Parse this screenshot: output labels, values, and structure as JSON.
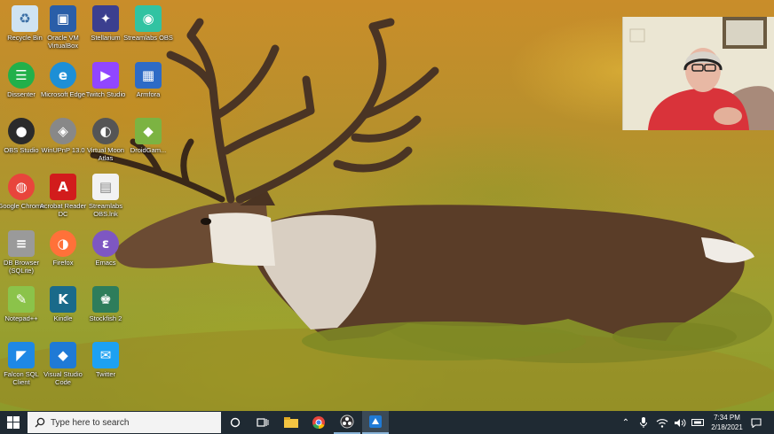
{
  "desktop": {
    "icons": [
      {
        "label": "Recycle Bin",
        "icon": "recycle-bin-icon",
        "color": "#cfe3f2"
      },
      {
        "label": "Oracle VM VirtualBox",
        "icon": "virtualbox-icon",
        "color": "#2a5ea8"
      },
      {
        "label": "Stellarium",
        "icon": "stellarium-icon",
        "color": "#3b3f8f"
      },
      {
        "label": "Streamlabs OBS",
        "icon": "streamlabs-icon",
        "color": "#31c3a2"
      },
      {
        "label": "Dissenter",
        "icon": "dissenter-icon",
        "color": "#22b04a"
      },
      {
        "label": "Microsoft Edge",
        "icon": "edge-icon",
        "color": "#1d8fd6"
      },
      {
        "label": "Twitch Studio",
        "icon": "twitch-icon",
        "color": "#9146ff"
      },
      {
        "label": "Armfora",
        "icon": "armfora-icon",
        "color": "#2e6bc6"
      },
      {
        "label": "OBS Studio",
        "icon": "obs-icon",
        "color": "#2b2b2b"
      },
      {
        "label": "WinUPnP 13.0",
        "icon": "winupnp-icon",
        "color": "#888888"
      },
      {
        "label": "Virtual Moon Atlas",
        "icon": "moon-atlas-icon",
        "color": "#555555"
      },
      {
        "label": "DroidGam...",
        "icon": "droid-icon",
        "color": "#7cb342"
      },
      {
        "label": "Google Chrome",
        "icon": "chrome-icon",
        "color": "#e8453c"
      },
      {
        "label": "Acrobat Reader DC",
        "icon": "acrobat-icon",
        "color": "#d21c1c"
      },
      {
        "label": "Streamlabs OBS.lnk",
        "icon": "file-icon",
        "color": "#f2f2f2"
      },
      {
        "label": "DB Browser (SQLite)",
        "icon": "database-icon",
        "color": "#9a9a9a"
      },
      {
        "label": "Firefox",
        "icon": "firefox-icon",
        "color": "#ff7139"
      },
      {
        "label": "Emacs",
        "icon": "emacs-icon",
        "color": "#7e57c2"
      },
      {
        "label": "Notepad++",
        "icon": "notepadpp-icon",
        "color": "#8bc34a"
      },
      {
        "label": "Kindle",
        "icon": "kindle-icon",
        "color": "#1a6a8a"
      },
      {
        "label": "Stockfish 2",
        "icon": "chess-icon",
        "color": "#2e7d5b"
      },
      {
        "label": "Falcon SQL Client",
        "icon": "falcon-icon",
        "color": "#1e88e5"
      },
      {
        "label": "Visual Studio Code",
        "icon": "vscode-icon",
        "color": "#1f7ad6"
      },
      {
        "label": "Twitter",
        "icon": "twitter-icon",
        "color": "#1da1f2"
      }
    ],
    "glyphs": [
      "♻",
      "▣",
      "✦",
      "◉",
      "☰",
      "e",
      "▶",
      "▦",
      "●",
      "◈",
      "◐",
      "◆",
      "◍",
      "A",
      "▤",
      "≡",
      "◑",
      "ε",
      "✎",
      "K",
      "♚",
      "◤",
      "◆",
      "✉"
    ]
  },
  "taskbar": {
    "search_placeholder": "Type here to search",
    "apps": [
      "cortana-icon",
      "task-view-icon",
      "file-explorer-icon",
      "chrome-icon",
      "obs-icon",
      "app-icon"
    ],
    "clock_time": "7:34 PM",
    "clock_date": "2/18/2021",
    "colors": {
      "bar": "#1f2a33",
      "accent": "#4cc2ff"
    }
  }
}
